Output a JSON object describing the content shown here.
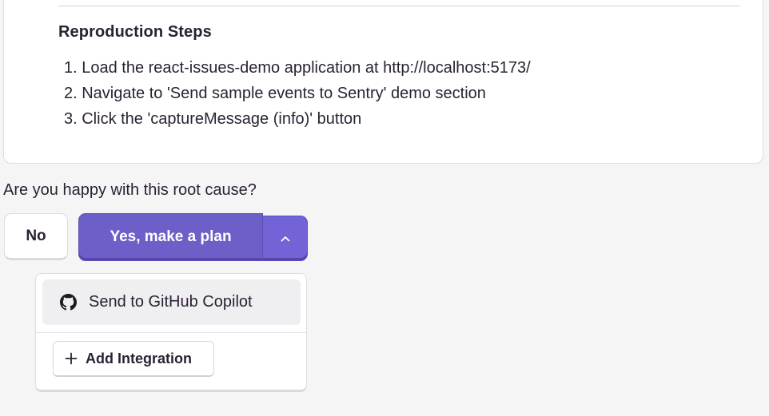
{
  "reproduction": {
    "title": "Reproduction Steps",
    "steps": [
      "1. Load the react-issues-demo application at http://localhost:5173/",
      "2. Navigate to 'Send sample events to Sentry' demo section",
      "3. Click the 'captureMessage (info)' button"
    ]
  },
  "feedback": {
    "question": "Are you happy with this root cause?",
    "no_label": "No",
    "yes_label": "Yes, make a plan",
    "chevron_icon": "chevron-up-icon"
  },
  "dropdown": {
    "items": [
      {
        "label": "Send to GitHub Copilot",
        "icon": "github-icon"
      }
    ],
    "add_integration_label": "Add Integration",
    "add_icon": "plus-icon"
  },
  "colors": {
    "primary": "#6c5fc7",
    "text": "#2b2233",
    "background": "#f6f5f6"
  }
}
